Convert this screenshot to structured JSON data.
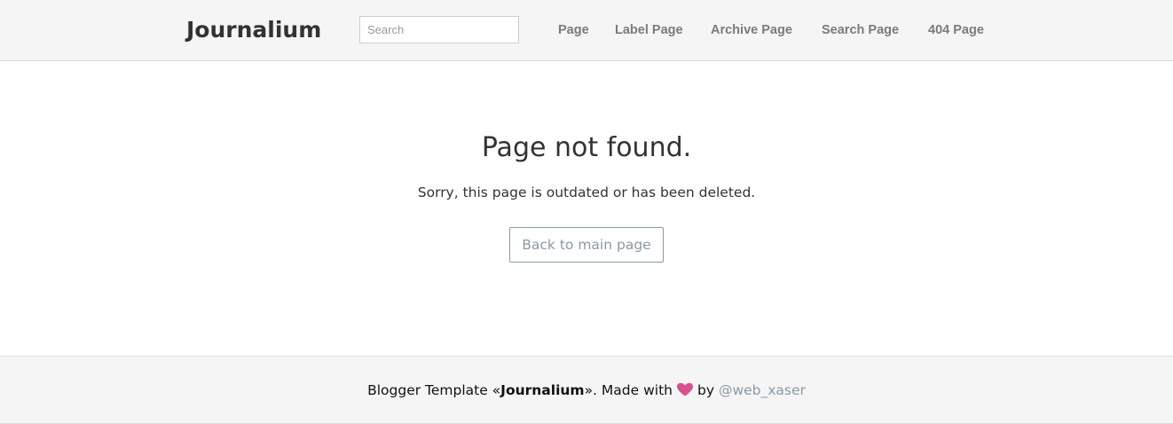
{
  "header": {
    "brand": "Journalium",
    "search": {
      "placeholder": "Search",
      "value": ""
    },
    "nav": [
      {
        "label": "Page"
      },
      {
        "label": "Label Page"
      },
      {
        "label": "Archive Page"
      },
      {
        "label": "Search Page"
      },
      {
        "label": "404 Page"
      }
    ]
  },
  "main": {
    "title": "Page not found.",
    "message": "Sorry, this page is outdated or has been deleted.",
    "back_button": "Back to main page"
  },
  "footer": {
    "prefix": "Blogger Template «",
    "template_name": "Journalium",
    "middle": "». Made with",
    "heart_icon": "heart-icon",
    "by": "by",
    "author": "@web_xaser"
  },
  "colors": {
    "header_bg": "#f5f5f5",
    "nav_text": "#7b7b7b",
    "accent_muted": "#8a9ba5",
    "heart": "#d6518e",
    "text": "#333333"
  }
}
